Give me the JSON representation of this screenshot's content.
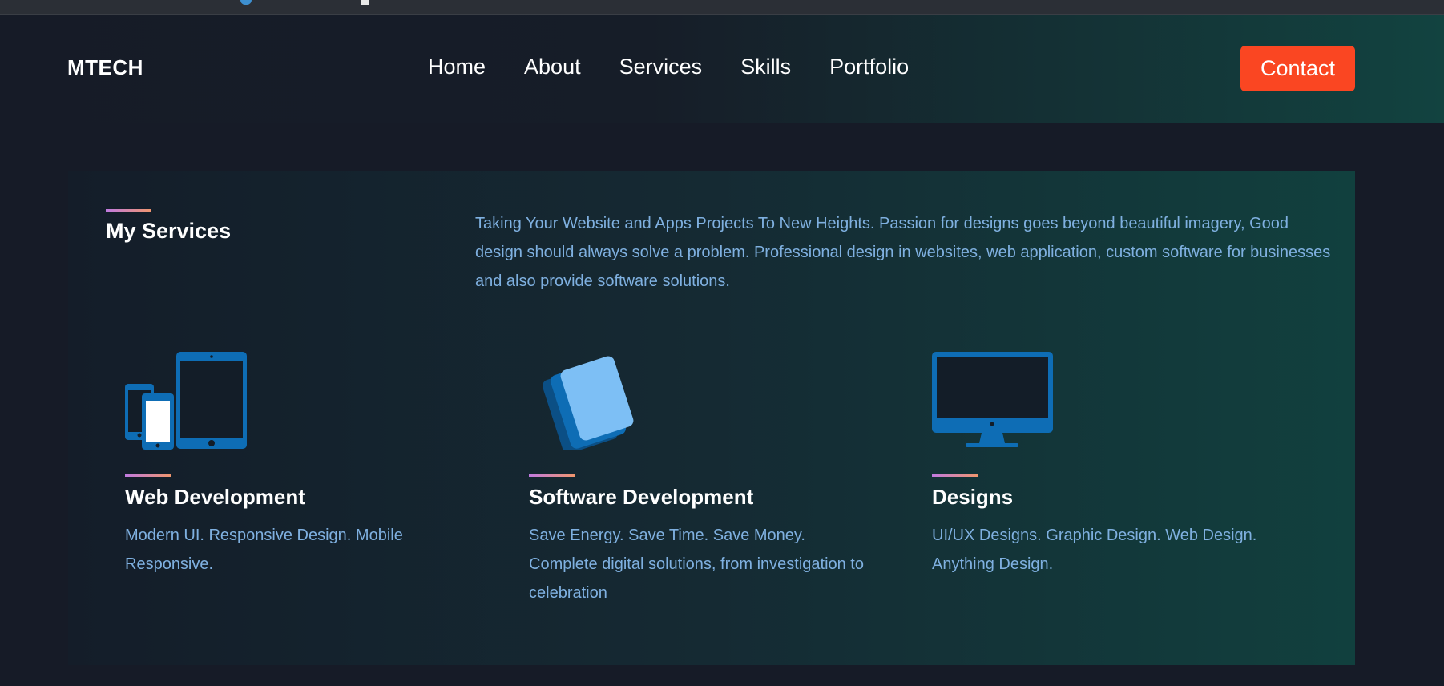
{
  "brand": {
    "name": "MTECH"
  },
  "nav": {
    "items": [
      {
        "label": "Home"
      },
      {
        "label": "About"
      },
      {
        "label": "Services"
      },
      {
        "label": "Skills"
      },
      {
        "label": "Portfolio"
      }
    ],
    "contact_label": "Contact"
  },
  "services": {
    "title": "My Services",
    "intro": "Taking Your Website and Apps Projects To New Heights. Passion for designs goes beyond beautiful imagery, Good design should always solve a problem. Professional design in websites, web application, custom software for businesses and also provide software solutions.",
    "cards": [
      {
        "icon": "devices-icon",
        "title": "Web Development",
        "description": "Modern UI. Responsive Design. Mobile Responsive."
      },
      {
        "icon": "software-layers-icon",
        "title": "Software Development",
        "description": "Save Energy. Save Time. Save Money. Complete digital solutions, from investigation to celebration"
      },
      {
        "icon": "desktop-monitor-icon",
        "title": "Designs",
        "description": "UI/UX Designs. Graphic Design. Web Design. Anything Design."
      }
    ]
  },
  "colors": {
    "background": "#161b27",
    "accent_button": "#fa4622",
    "text_blue": "#7fb0e0",
    "icon_blue": "#0e6db5",
    "icon_light_blue": "#7dbff5",
    "underline_gradient_start": "#c07ae0",
    "underline_gradient_end": "#f0966e"
  }
}
